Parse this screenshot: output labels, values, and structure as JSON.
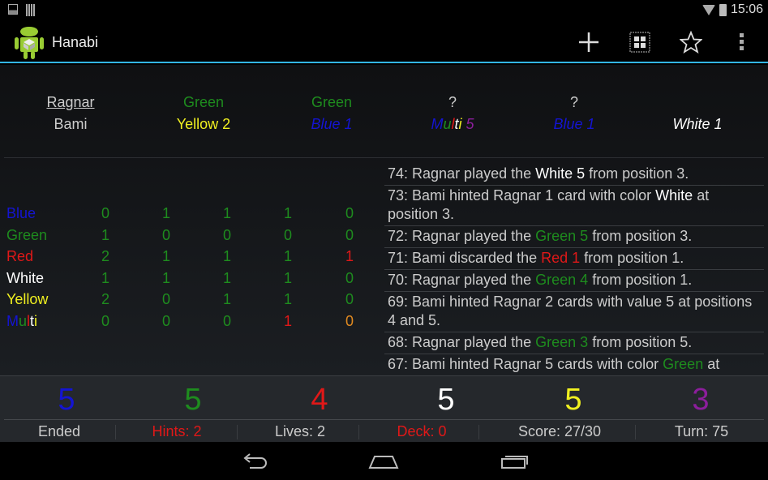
{
  "status_bar": {
    "time": "15:06",
    "icons": [
      "image-icon",
      "barcode-icon",
      "wifi-icon",
      "battery-charging-icon"
    ]
  },
  "action_bar": {
    "title": "Hanabi",
    "actions": [
      {
        "name": "add-icon"
      },
      {
        "name": "grid-icon"
      },
      {
        "name": "star-icon"
      },
      {
        "name": "overflow-menu-icon"
      }
    ]
  },
  "colors": {
    "blue": "#1414d2",
    "green": "#1e8c1e",
    "red": "#e01818",
    "white": "#ffffff",
    "yellow": "#f0f020",
    "purple": "#8c1e9c",
    "orange": "#e08a20",
    "gray": "#cccccc",
    "accent": "#33b5e5"
  },
  "hand": {
    "player_active": "Ragnar",
    "player_other": "Bami",
    "hints": [
      "Green",
      "Green",
      "?",
      "?",
      ""
    ],
    "cards": [
      {
        "segments": [
          {
            "t": "Yellow 2",
            "c": "yellow"
          }
        ],
        "italic": false
      },
      {
        "segments": [
          {
            "t": "Blue 1",
            "c": "blue"
          }
        ],
        "italic": true
      },
      {
        "segments": [
          {
            "t": "M",
            "c": "blue"
          },
          {
            "t": "u",
            "c": "green"
          },
          {
            "t": "l",
            "c": "red"
          },
          {
            "t": "t",
            "c": "white"
          },
          {
            "t": "i",
            "c": "yellow"
          },
          {
            "t": " 5",
            "c": "purple"
          }
        ],
        "italic": true
      },
      {
        "segments": [
          {
            "t": "Blue 1",
            "c": "blue"
          }
        ],
        "italic": true
      },
      {
        "segments": [
          {
            "t": "White 1",
            "c": "white"
          }
        ],
        "italic": true
      }
    ]
  },
  "table": [
    {
      "label": [
        {
          "t": "Blue",
          "c": "blue"
        }
      ],
      "values": [
        {
          "v": "0",
          "c": "green"
        },
        {
          "v": "1",
          "c": "green"
        },
        {
          "v": "1",
          "c": "green"
        },
        {
          "v": "1",
          "c": "green"
        },
        {
          "v": "0",
          "c": "green"
        }
      ]
    },
    {
      "label": [
        {
          "t": "Green",
          "c": "green"
        }
      ],
      "values": [
        {
          "v": "1",
          "c": "green"
        },
        {
          "v": "0",
          "c": "green"
        },
        {
          "v": "0",
          "c": "green"
        },
        {
          "v": "0",
          "c": "green"
        },
        {
          "v": "0",
          "c": "green"
        }
      ]
    },
    {
      "label": [
        {
          "t": "Red",
          "c": "red"
        }
      ],
      "values": [
        {
          "v": "2",
          "c": "green"
        },
        {
          "v": "1",
          "c": "green"
        },
        {
          "v": "1",
          "c": "green"
        },
        {
          "v": "1",
          "c": "green"
        },
        {
          "v": "1",
          "c": "red"
        }
      ]
    },
    {
      "label": [
        {
          "t": "White",
          "c": "white"
        }
      ],
      "values": [
        {
          "v": "1",
          "c": "green"
        },
        {
          "v": "1",
          "c": "green"
        },
        {
          "v": "1",
          "c": "green"
        },
        {
          "v": "1",
          "c": "green"
        },
        {
          "v": "0",
          "c": "green"
        }
      ]
    },
    {
      "label": [
        {
          "t": "Yellow",
          "c": "yellow"
        }
      ],
      "values": [
        {
          "v": "2",
          "c": "green"
        },
        {
          "v": "0",
          "c": "green"
        },
        {
          "v": "1",
          "c": "green"
        },
        {
          "v": "1",
          "c": "green"
        },
        {
          "v": "0",
          "c": "green"
        }
      ]
    },
    {
      "label": [
        {
          "t": "M",
          "c": "blue"
        },
        {
          "t": "u",
          "c": "green"
        },
        {
          "t": "l",
          "c": "red"
        },
        {
          "t": "t",
          "c": "white"
        },
        {
          "t": "i",
          "c": "yellow"
        }
      ],
      "values": [
        {
          "v": "0",
          "c": "green"
        },
        {
          "v": "0",
          "c": "green"
        },
        {
          "v": "0",
          "c": "green"
        },
        {
          "v": "1",
          "c": "red"
        },
        {
          "v": "0",
          "c": "orange"
        }
      ]
    }
  ],
  "log": [
    [
      {
        "t": "74: Ragnar played the ",
        "c": "gray"
      },
      {
        "t": "White 5",
        "c": "white"
      },
      {
        "t": " from position 3.",
        "c": "gray"
      }
    ],
    [
      {
        "t": "73: Bami hinted Ragnar 1 card with color ",
        "c": "gray"
      },
      {
        "t": "White",
        "c": "white"
      },
      {
        "t": " at position 3.",
        "c": "gray"
      }
    ],
    [
      {
        "t": "72: Ragnar played the ",
        "c": "gray"
      },
      {
        "t": "Green 5",
        "c": "green"
      },
      {
        "t": " from position 3.",
        "c": "gray"
      }
    ],
    [
      {
        "t": "71: Bami discarded the ",
        "c": "gray"
      },
      {
        "t": "Red 1",
        "c": "red"
      },
      {
        "t": " from position 1.",
        "c": "gray"
      }
    ],
    [
      {
        "t": "70: Ragnar played the ",
        "c": "gray"
      },
      {
        "t": "Green 4",
        "c": "green"
      },
      {
        "t": " from position 1.",
        "c": "gray"
      }
    ],
    [
      {
        "t": "69: Bami hinted Ragnar 2 cards with value 5 at positions 4 and 5.",
        "c": "gray"
      }
    ],
    [
      {
        "t": "68: Ragnar played the ",
        "c": "gray"
      },
      {
        "t": "Green 3",
        "c": "green"
      },
      {
        "t": " from position 5.",
        "c": "gray"
      }
    ],
    [
      {
        "t": "67: Bami hinted Ragnar 5 cards with color ",
        "c": "gray"
      },
      {
        "t": "Green",
        "c": "green"
      },
      {
        "t": " at",
        "c": "gray"
      }
    ]
  ],
  "piles": [
    {
      "v": "5",
      "c": "blue"
    },
    {
      "v": "5",
      "c": "green"
    },
    {
      "v": "4",
      "c": "red"
    },
    {
      "v": "5",
      "c": "white"
    },
    {
      "v": "5",
      "c": "yellow"
    },
    {
      "v": "3",
      "c": "purple"
    }
  ],
  "stats": [
    {
      "t": "Ended",
      "c": "gray"
    },
    {
      "t": "Hints: 2",
      "c": "red"
    },
    {
      "t": "Lives: 2",
      "c": "gray"
    },
    {
      "t": "Deck: 0",
      "c": "red"
    },
    {
      "t": "Score: 27/30",
      "c": "gray"
    },
    {
      "t": "Turn: 75",
      "c": "gray"
    }
  ],
  "nav": [
    "back-icon",
    "home-icon",
    "recent-apps-icon"
  ]
}
